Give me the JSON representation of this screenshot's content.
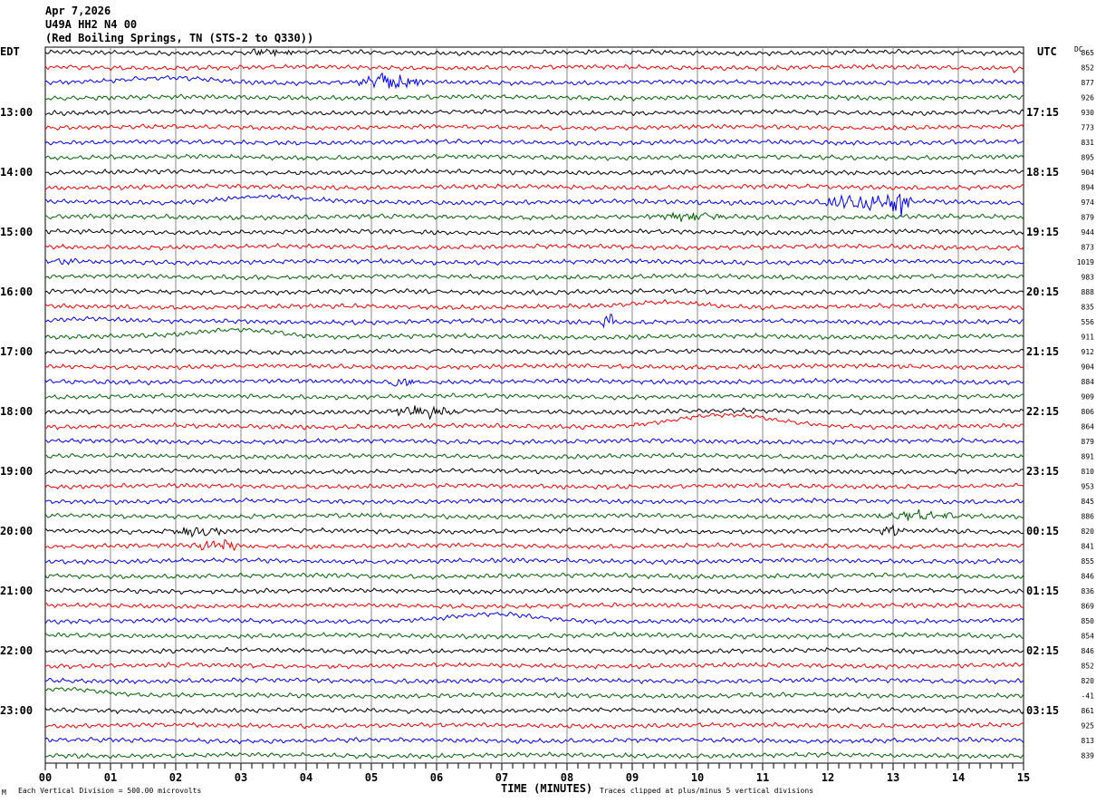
{
  "header": {
    "date": "Apr 7,2026",
    "channel": "U49A HH2 N4 00",
    "location": "(Red Boiling Springs, TN (STS-2 to Q330))"
  },
  "left_zone_label": "EDT",
  "right_zone_label": "UTC",
  "dc_header": "DC",
  "footer": {
    "scale_note": "Each Vertical Division =  500.00 microvolts",
    "xlabel": "TIME (MINUTES)",
    "clip_note": "Traces clipped at plus/minus 5 vertical divisions",
    "corner_mark": "M"
  },
  "chart_data": {
    "type": "line",
    "title": "U49A HH2 N4 00 helicorder",
    "xlabel": "TIME (MINUTES)",
    "xlim": [
      0,
      15
    ],
    "x_ticks": [
      "00",
      "01",
      "02",
      "03",
      "04",
      "05",
      "06",
      "07",
      "08",
      "09",
      "10",
      "11",
      "12",
      "13",
      "14",
      "15"
    ],
    "trace_colors": [
      "#000000",
      "#ff0000",
      "#0000ff",
      "#006400"
    ],
    "rows_per_hour": 4,
    "left_hour_labels": [
      "13:00",
      "14:00",
      "15:00",
      "16:00",
      "17:00",
      "18:00",
      "19:00",
      "20:00",
      "21:00",
      "22:00",
      "23:00"
    ],
    "right_hour_labels": [
      "17:15",
      "18:15",
      "19:15",
      "20:15",
      "21:15",
      "22:15",
      "23:15",
      "00:15",
      "01:15",
      "02:15",
      "03:15"
    ],
    "first_labeled_row": 4,
    "dc_values": [
      "865",
      "852",
      "877",
      "926",
      "930",
      "773",
      "831",
      "895",
      "904",
      "894",
      "974",
      "879",
      "944",
      "873",
      "1019",
      "983",
      "888",
      "835",
      "556",
      "911",
      "912",
      "904",
      "884",
      "909",
      "806",
      "864",
      "879",
      "891",
      "810",
      "953",
      "845",
      "886",
      "820",
      "841",
      "855",
      "846",
      "836",
      "869",
      "850",
      "854",
      "846",
      "852",
      "820",
      "-41",
      "861",
      "925",
      "813",
      "839"
    ],
    "events": [
      {
        "row": 0,
        "minute": 3.1,
        "dur": 0.8,
        "amp": 6
      },
      {
        "row": 1,
        "minute": 14.6,
        "dur": 0.4,
        "amp": 6
      },
      {
        "row": 2,
        "minute": 4.7,
        "dur": 1.2,
        "amp": 10
      },
      {
        "row": 10,
        "minute": 11.8,
        "dur": 1.4,
        "amp": 10
      },
      {
        "row": 10,
        "minute": 12.8,
        "dur": 0.5,
        "amp": 22
      },
      {
        "row": 11,
        "minute": 9.1,
        "dur": 1.5,
        "amp": 5
      },
      {
        "row": 14,
        "minute": 0.1,
        "dur": 0.5,
        "amp": 4
      },
      {
        "row": 18,
        "minute": 8.5,
        "dur": 0.3,
        "amp": 10
      },
      {
        "row": 22,
        "minute": 5.2,
        "dur": 0.6,
        "amp": 5
      },
      {
        "row": 24,
        "minute": 5.2,
        "dur": 1.3,
        "amp": 9
      },
      {
        "row": 31,
        "minute": 12.6,
        "dur": 1.5,
        "amp": 6
      },
      {
        "row": 32,
        "minute": 1.7,
        "dur": 1.2,
        "amp": 5
      },
      {
        "row": 32,
        "minute": 12.7,
        "dur": 0.5,
        "amp": 6
      },
      {
        "row": 33,
        "minute": 2.2,
        "dur": 0.8,
        "amp": 7
      }
    ],
    "swells": [
      {
        "row": 2,
        "minute": 2.0,
        "width": 1.2,
        "amp": -5
      },
      {
        "row": 10,
        "minute": 3.3,
        "width": 1.2,
        "amp": -6
      },
      {
        "row": 18,
        "minute": 0.6,
        "width": 1.0,
        "amp": -4
      },
      {
        "row": 19,
        "minute": 3.0,
        "width": 1.2,
        "amp": -8
      },
      {
        "row": 17,
        "minute": 9.6,
        "width": 1.0,
        "amp": -5
      },
      {
        "row": 25,
        "minute": 10.4,
        "width": 1.5,
        "amp": -12
      },
      {
        "row": 38,
        "minute": 6.9,
        "width": 1.2,
        "amp": -7
      },
      {
        "row": 43,
        "minute": 0.3,
        "width": 1.2,
        "amp": -8
      }
    ]
  }
}
